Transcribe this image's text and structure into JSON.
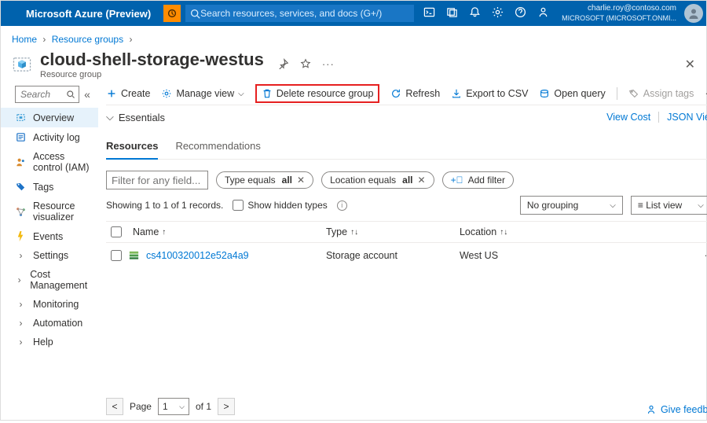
{
  "topbar": {
    "brand": "Microsoft Azure (Preview)",
    "search_placeholder": "Search resources, services, and docs (G+/)",
    "user_email": "charlie.roy@contoso.com",
    "user_tenant": "MICROSOFT (MICROSOFT.ONMI..."
  },
  "breadcrumb": {
    "home": "Home",
    "rg": "Resource groups"
  },
  "title": {
    "name": "cloud-shell-storage-westus",
    "subtitle": "Resource group"
  },
  "sidebar": {
    "search_placeholder": "Search",
    "items": [
      {
        "label": "Overview"
      },
      {
        "label": "Activity log"
      },
      {
        "label": "Access control (IAM)"
      },
      {
        "label": "Tags"
      },
      {
        "label": "Resource visualizer"
      },
      {
        "label": "Events"
      },
      {
        "label": "Settings"
      },
      {
        "label": "Cost Management"
      },
      {
        "label": "Monitoring"
      },
      {
        "label": "Automation"
      },
      {
        "label": "Help"
      }
    ]
  },
  "toolbar": {
    "create": "Create",
    "manage": "Manage view",
    "delete": "Delete resource group",
    "refresh": "Refresh",
    "export": "Export to CSV",
    "open_query": "Open query",
    "assign_tags": "Assign tags"
  },
  "essentials": {
    "label": "Essentials",
    "view_cost": "View Cost",
    "json_view": "JSON View"
  },
  "tabs": {
    "resources": "Resources",
    "recs": "Recommendations"
  },
  "filters": {
    "placeholder": "Filter for any field...",
    "type_prefix": "Type equals",
    "type_value": "all",
    "location_prefix": "Location equals",
    "location_value": "all",
    "add": "Add filter"
  },
  "options": {
    "showing": "Showing 1 to 1 of 1 records.",
    "hidden_types": "Show hidden types",
    "grouping": "No grouping",
    "view": "List view"
  },
  "table": {
    "col_name": "Name",
    "col_type": "Type",
    "col_location": "Location",
    "rows": [
      {
        "name": "cs4100320012e52a4a9",
        "type": "Storage account",
        "location": "West US"
      }
    ]
  },
  "pager": {
    "page_label": "Page",
    "current": "1",
    "of": "of 1"
  },
  "feedback": "Give feedback"
}
